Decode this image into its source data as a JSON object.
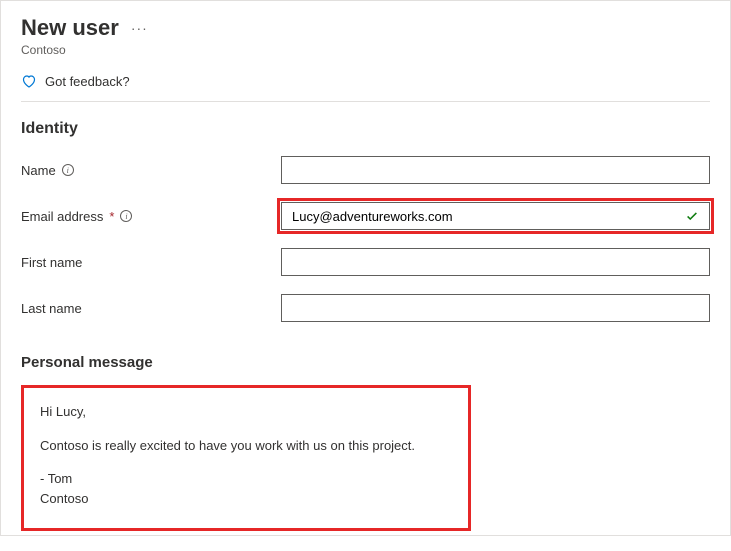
{
  "header": {
    "title": "New user",
    "org": "Contoso",
    "more_actions": "···"
  },
  "feedback": {
    "label": "Got feedback?"
  },
  "sections": {
    "identity": {
      "title": "Identity",
      "fields": {
        "name": {
          "label": "Name",
          "value": "",
          "required": false
        },
        "email": {
          "label": "Email address",
          "value": "Lucy@adventureworks.com",
          "required": true,
          "validated": true
        },
        "first_name": {
          "label": "First name",
          "value": "",
          "required": false
        },
        "last_name": {
          "label": "Last name",
          "value": "",
          "required": false
        }
      }
    },
    "personal_message": {
      "title": "Personal message",
      "greeting": "Hi Lucy,",
      "body": "Contoso is really excited to have you work with us on this project.",
      "sign1": "- Tom",
      "sign2": "Contoso"
    }
  },
  "colors": {
    "highlight": "#e62727",
    "success": "#107c10"
  }
}
